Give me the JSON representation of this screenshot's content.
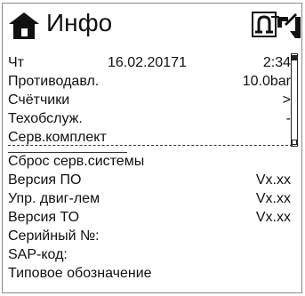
{
  "header": {
    "title": "Инфо",
    "home_icon": "home-icon",
    "control_icons": [
      "manual-control-icon",
      "auto-control-icon"
    ]
  },
  "info_rows": [
    {
      "label": "Чт",
      "middle": "16.02.20171",
      "value": "2:34"
    },
    {
      "label": "Противодавл.",
      "value": "10.0bar"
    },
    {
      "label": "Счётчики",
      "value": ">"
    },
    {
      "label": "Техобслуж.",
      "value": "-"
    },
    {
      "label": "Серв.комплект",
      "value": ""
    }
  ],
  "service_rows": [
    {
      "label": "Сброс серв.системы",
      "value": ""
    },
    {
      "label": "Версия ПО",
      "value": "Vx.xx"
    },
    {
      "label": "Упр. двиг-лем",
      "value": "Vx.xx"
    },
    {
      "label": "Версия ТО",
      "value": "Vx.xx"
    },
    {
      "label": "Серийный №:",
      "value": ""
    },
    {
      "label": "SAP-код:",
      "value": ""
    },
    {
      "label": "Типовое обозначение",
      "value": ""
    }
  ],
  "colors": {
    "text": "#111111",
    "background": "#ffffff",
    "border": "#8a8a8a"
  }
}
